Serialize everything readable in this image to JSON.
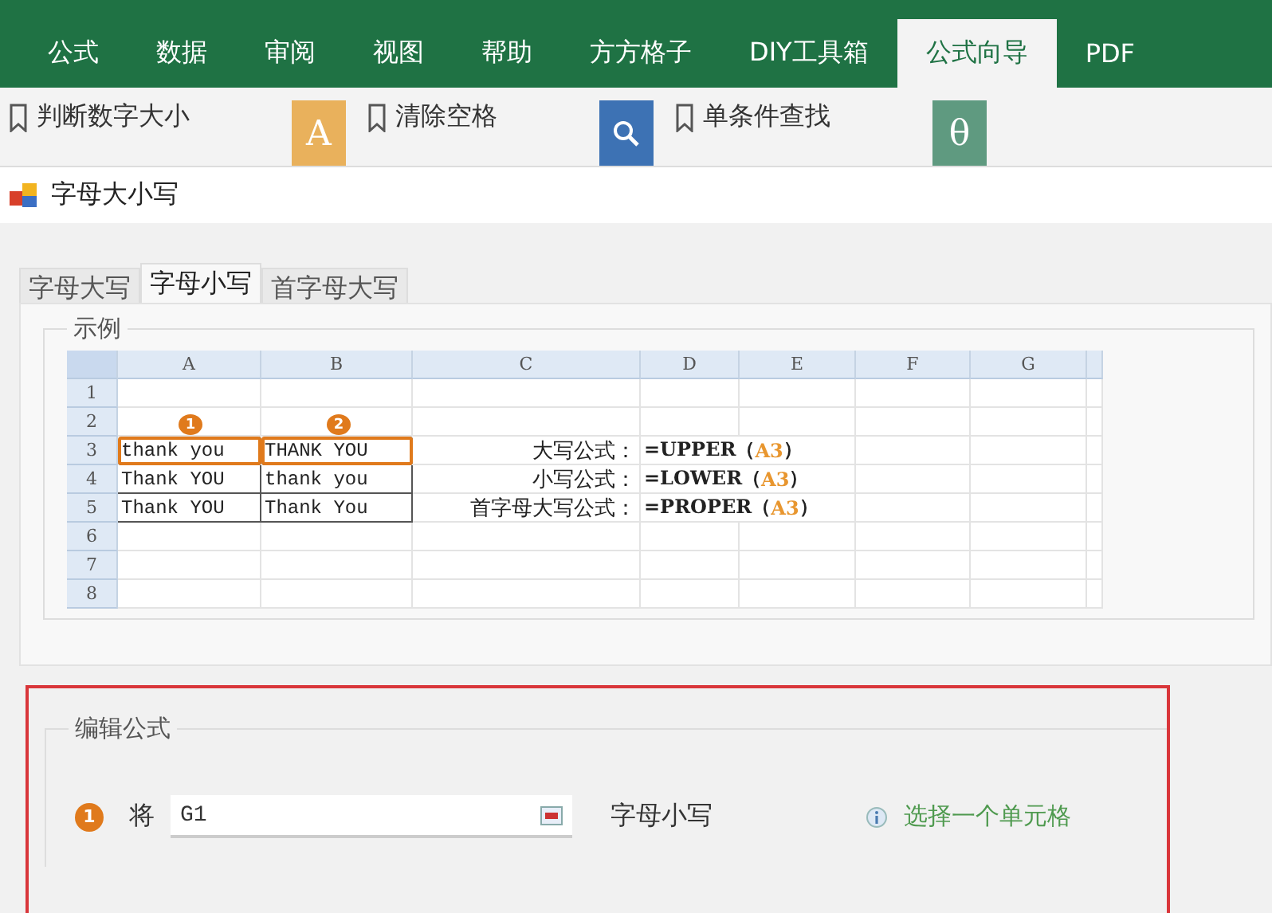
{
  "ribbon_tabs": [
    {
      "label": "公式",
      "selected": false
    },
    {
      "label": "数据",
      "selected": false
    },
    {
      "label": "审阅",
      "selected": false
    },
    {
      "label": "视图",
      "selected": false
    },
    {
      "label": "帮助",
      "selected": false
    },
    {
      "label": "方方格子",
      "selected": false
    },
    {
      "label": "DIY工具箱",
      "selected": false
    },
    {
      "label": "公式向导",
      "selected": true
    },
    {
      "label": "PDF",
      "selected": false
    }
  ],
  "ribbon_items": [
    {
      "kind": "command",
      "label": "判断数字大小"
    },
    {
      "kind": "tile",
      "glyph": "A",
      "color": "#e9b15c"
    },
    {
      "kind": "command",
      "label": "清除空格"
    },
    {
      "kind": "search",
      "color": "#3d72b4"
    },
    {
      "kind": "command",
      "label": "单条件查找"
    },
    {
      "kind": "tile",
      "glyph": "θ",
      "color": "#5f9a80"
    }
  ],
  "dialog": {
    "title": "字母大小写",
    "tabs": [
      {
        "label": "字母大写",
        "selected": false
      },
      {
        "label": "字母小写",
        "selected": true
      },
      {
        "label": "首字母大写",
        "selected": false
      }
    ],
    "example": {
      "legend": "示例",
      "columns": [
        "A",
        "B",
        "C",
        "D",
        "E",
        "F",
        "G"
      ],
      "row_numbers": [
        "1",
        "2",
        "3",
        "4",
        "5",
        "6",
        "7",
        "8"
      ],
      "markers": [
        {
          "label": "1"
        },
        {
          "label": "2"
        }
      ],
      "rows": [
        {
          "a": "thank you",
          "b": "THANK YOU",
          "highlighted": true,
          "label": "大写公式：",
          "formula": {
            "prefix": "=UPPER（",
            "ref": "A3",
            "suffix": "）"
          }
        },
        {
          "a": "Thank YOU",
          "b": "thank you",
          "highlighted": false,
          "label": "小写公式：",
          "formula": {
            "prefix": "=LOWER（",
            "ref": "A3",
            "suffix": "）"
          }
        },
        {
          "a": "Thank YOU",
          "b": "Thank You",
          "highlighted": false,
          "label": "首字母大写公式：",
          "formula": {
            "prefix": "=PROPER（",
            "ref": "A3",
            "suffix": "）"
          }
        }
      ]
    },
    "edit": {
      "legend": "编辑公式",
      "step": "1",
      "prefix": "将",
      "value": "G1",
      "result": "字母小写",
      "hint": "选择一个单元格"
    }
  }
}
